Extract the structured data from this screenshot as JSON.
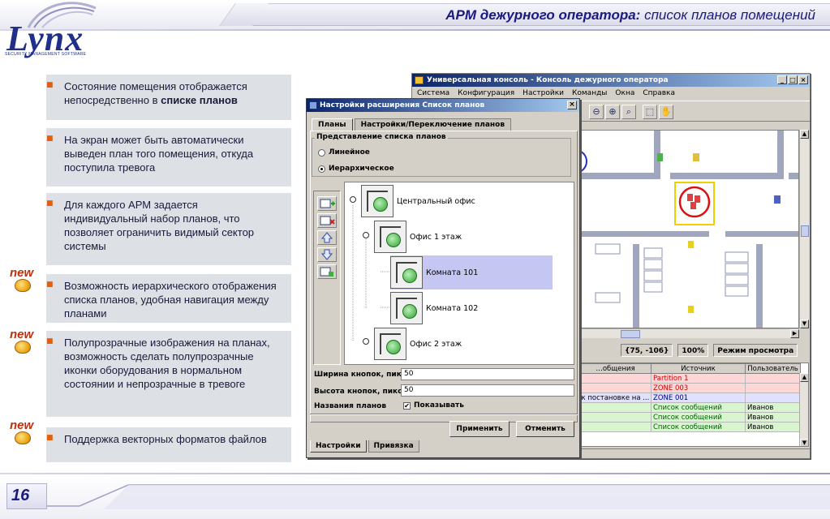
{
  "slide": {
    "title_bold": "АРМ дежурного оператора:",
    "title_rest": " список планов помещений",
    "logo_text": "Lynx",
    "logo_sub": "SECURITY MANAGEMENT SOFTWARE",
    "page_number": "16",
    "new_badge": "new"
  },
  "bullets": [
    {
      "pre": "Состояние помещения отображается непосредственно в ",
      "bold": "списке планов",
      "post": "",
      "is_new": false
    },
    {
      "pre": "На экран может быть автоматически выведен план того помещения, откуда поступила тревога",
      "bold": "",
      "post": "",
      "is_new": false
    },
    {
      "pre": "Для каждого АРМ задается индивидуальный набор планов, что позволяет ограничить видимый сектор системы",
      "bold": "",
      "post": "",
      "is_new": false
    },
    {
      "pre": "Возможность иерархического отображения списка планов, удобная навигация между планами",
      "bold": "",
      "post": "",
      "is_new": true
    },
    {
      "pre": "Полупрозрачные изображения на планах, возможность сделать полупрозрачные иконки оборудования в нормальном состоянии и непрозрачные в тревоге",
      "bold": "",
      "post": "",
      "is_new": true
    },
    {
      "pre": "Поддержка векторных форматов файлов",
      "bold": "",
      "post": "",
      "is_new": true
    }
  ],
  "console": {
    "title": "Универсальная консоль - Консоль дежурного оператора",
    "win_buttons": [
      "_",
      "□",
      "×"
    ],
    "menu": [
      "Система",
      "Конфигурация",
      "Настройки",
      "Команды",
      "Окна",
      "Справка"
    ],
    "status": {
      "coords": "{75, -106}",
      "zoom": "100%",
      "mode": "Режим просмотра"
    },
    "log": {
      "columns": [
        "…общения",
        "Источник",
        "Пользователь"
      ],
      "rows": [
        {
          "message": "",
          "source": "Partition 1",
          "user": "",
          "color": "#ffd6d6",
          "text_color": "#cc0000"
        },
        {
          "message": "",
          "source": "ZONE 003",
          "user": "",
          "color": "#ffd6d6",
          "text_color": "#cc0000"
        },
        {
          "message": "к постановке на ...",
          "source": "ZONE 001",
          "user": "",
          "color": "#e0e0ff",
          "text_color": "#000080"
        },
        {
          "message": "",
          "source": "Список сообщений",
          "user": "Иванов",
          "color": "#d8f5d0",
          "text_color": "#006000"
        },
        {
          "message": "",
          "source": "Список сообщений",
          "user": "Иванов",
          "color": "#d8f5d0",
          "text_color": "#006000"
        },
        {
          "message": "",
          "source": "Список сообщений",
          "user": "Иванов",
          "color": "#d8f5d0",
          "text_color": "#006000"
        }
      ]
    }
  },
  "dialog": {
    "title": "Настройки расширения Список планов",
    "close": "×",
    "tabs": [
      "Планы",
      "Настройки/Переключение планов"
    ],
    "group_label": "Представление списка планов",
    "radio_linear": "Линейное",
    "radio_hier": "Иерархическое",
    "tree": [
      {
        "label": "Центральный офис",
        "selected": false
      },
      {
        "label": "Офис 1 этаж",
        "selected": false
      },
      {
        "label": "Комната 101",
        "selected": true
      },
      {
        "label": "Комната 102",
        "selected": false
      },
      {
        "label": "Офис 2 этаж",
        "selected": false
      }
    ],
    "width_label": "Ширина кнопок, пикс:",
    "width_value": "50",
    "height_label": "Высота кнопок, пикс:",
    "height_value": "50",
    "names_label": "Названия планов",
    "show_label": "Показывать",
    "show_mark": "✔",
    "apply": "Применить",
    "cancel": "Отменить",
    "bottom_tabs": [
      "Настройки",
      "Привязка"
    ]
  },
  "colors": {
    "title_blue": "#1a1a80",
    "bullet_marker": "#e06010",
    "selection": "#c6c6f2",
    "titlebar_start": "#0a246a",
    "titlebar_end": "#a6caf0"
  }
}
